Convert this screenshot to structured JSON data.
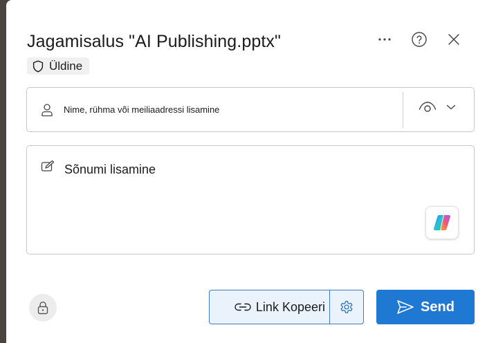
{
  "dialog": {
    "title": "Jagamisalus \"AI Publishing.pptx\"",
    "sensitivity_label": "Üldine"
  },
  "header_icons": [
    "more-options-icon",
    "help-icon",
    "close-icon"
  ],
  "recipients": {
    "placeholder": "Nime, rühma või meiliaadressi lisamine",
    "permission_icon": "eye-icon"
  },
  "message": {
    "placeholder": "Sõnumi lisamine"
  },
  "footer": {
    "copy_link_label": "Link Kopeeri",
    "send_label": "Send"
  },
  "colors": {
    "accent": "#1f78d1",
    "link_button_bg": "#eaf3fc",
    "link_button_border": "#3b7bc4"
  }
}
